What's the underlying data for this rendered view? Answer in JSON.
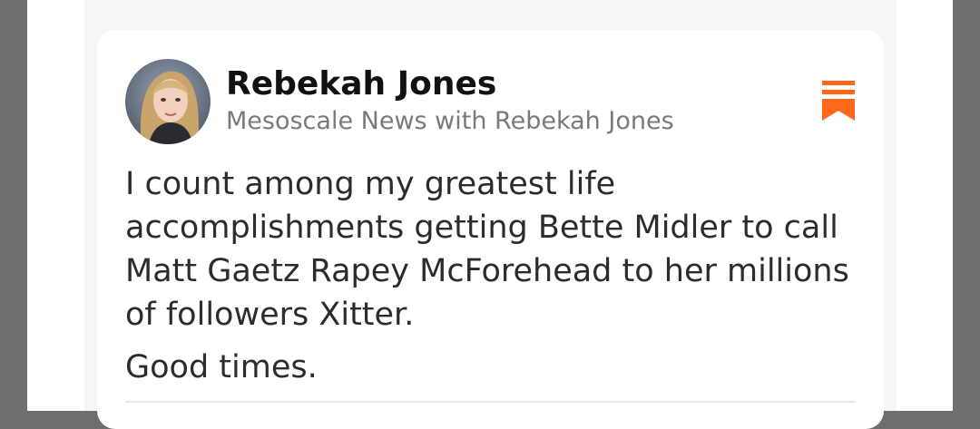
{
  "post": {
    "author_name": "Rebekah Jones",
    "publication": "Mesoscale News with Rebekah Jones",
    "paragraphs": [
      "I count among my greatest life accomplishments getting Bette Midler to call Matt Gaetz Rapey McForehead to her millions of followers Xitter.",
      "Good times."
    ]
  },
  "icons": {
    "avatar": "author-avatar-photo",
    "bookmark": "bookmark-icon"
  },
  "colors": {
    "accent": "#ff6719",
    "author_text": "#111111",
    "publication_text": "#7a7a7a",
    "body_text": "#2c2c2c",
    "feed_background": "#f6f6f6",
    "outer_background": "#6e6e6e"
  }
}
